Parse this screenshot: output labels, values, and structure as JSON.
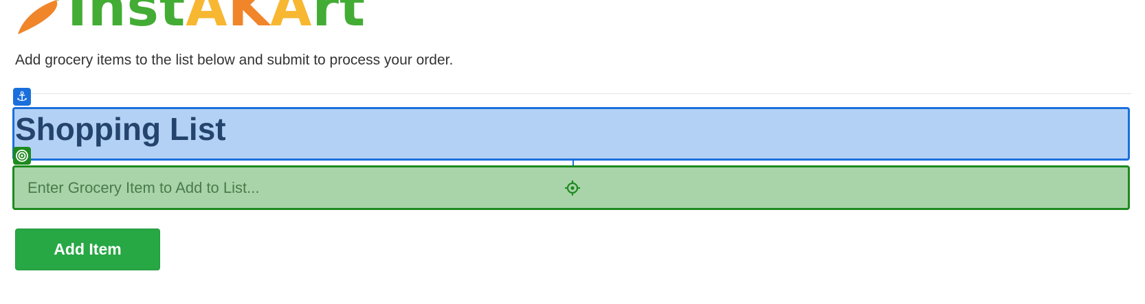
{
  "brand": {
    "logo_text": "InstAKArt",
    "colors": {
      "green": "#43ac34",
      "yellow": "#f7b731",
      "orange": "#f0852a"
    }
  },
  "intro_text": "Add grocery items to the list below and submit to process your order.",
  "heading": "Shopping List",
  "grocery_input": {
    "placeholder": "Enter Grocery Item to Add to List...",
    "value": ""
  },
  "add_button_label": "Add Item",
  "overlay": {
    "anchor_icon": "anchor-icon",
    "target_icon": "target-icon",
    "crosshair_icon": "crosshair-icon",
    "heading_highlight_color": "#1a6fdc",
    "input_highlight_color": "#1e8a1e"
  }
}
